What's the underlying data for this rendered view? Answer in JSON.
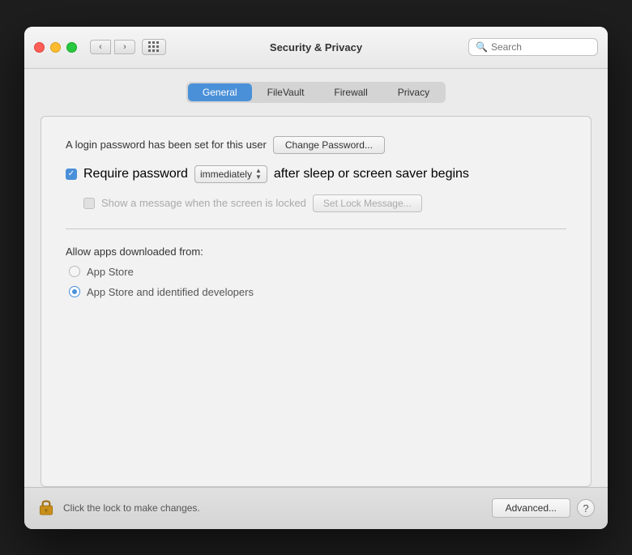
{
  "window": {
    "title": "Security & Privacy"
  },
  "titlebar": {
    "back_label": "‹",
    "forward_label": "›",
    "search_placeholder": "Search"
  },
  "tabs": {
    "items": [
      {
        "label": "General",
        "active": true
      },
      {
        "label": "FileVault",
        "active": false
      },
      {
        "label": "Firewall",
        "active": false
      },
      {
        "label": "Privacy",
        "active": false
      }
    ]
  },
  "general": {
    "login_password_text": "A login password has been set for this user",
    "change_password_label": "Change Password...",
    "require_password_label": "Require password",
    "require_password_value": "immediately",
    "after_sleep_text": "after sleep or screen saver begins",
    "show_message_label": "Show a message when the screen is locked",
    "set_lock_message_label": "Set Lock Message...",
    "allow_apps_label": "Allow apps downloaded from:",
    "radio_app_store": "App Store",
    "radio_app_store_identified": "App Store and identified developers",
    "require_password_checked": true,
    "show_message_checked": false,
    "radio_selected": "app_store_identified"
  },
  "bottom": {
    "lock_text": "Click the lock to make changes.",
    "advanced_label": "Advanced...",
    "help_label": "?"
  }
}
